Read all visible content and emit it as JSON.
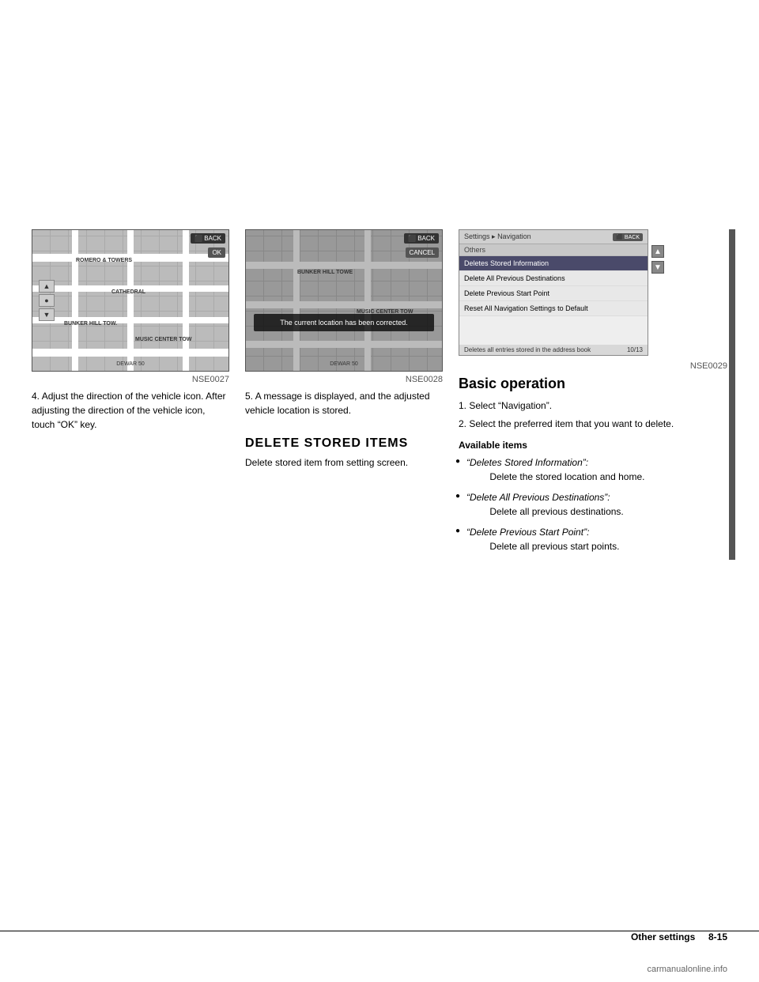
{
  "page": {
    "background": "#ffffff",
    "section": "Other settings",
    "page_number": "8-15"
  },
  "images": {
    "first": {
      "caption": "NSE0027",
      "alt": "Map showing vehicle direction adjustment with OK button"
    },
    "second": {
      "caption": "NSE0028",
      "alt": "Map with message: The current location has been corrected.",
      "message": "The current location has been corrected."
    },
    "third": {
      "caption": "NSE0029",
      "alt": "Navigation Settings menu showing delete options",
      "header_title": "Settings",
      "header_subtitle": "Navigation",
      "section_label": "Others",
      "menu_items": [
        {
          "label": "Deletes Stored Information",
          "selected": true
        },
        {
          "label": "Delete All Previous Destinations",
          "selected": false
        },
        {
          "label": "Delete Previous Start Point",
          "selected": false
        },
        {
          "label": "Reset All Navigation Settings to Default",
          "selected": false
        }
      ],
      "footer_text": "Deletes all entries stored in the address book",
      "page_indicator": "10/13"
    }
  },
  "steps": {
    "step4": {
      "number": "4.",
      "text": "Adjust the direction of the vehicle icon. After adjusting the direction of the vehicle icon, touch “OK” key."
    },
    "step5": {
      "number": "5.",
      "text": "A message is displayed, and the adjusted vehicle location is stored."
    }
  },
  "delete_section": {
    "heading": "DELETE STORED ITEMS",
    "subtext": "Delete stored item from setting screen."
  },
  "basic_operation": {
    "heading": "Basic operation",
    "step1": "1.  Select “Navigation”.",
    "step2": "2.  Select the preferred item that you want to delete.",
    "available_items_heading": "Available items",
    "items": [
      {
        "label": "“Deletes Stored Information”:",
        "description": "Delete the stored location and home."
      },
      {
        "label": "“Delete All Previous Destinations”:",
        "description": "Delete all previous destinations."
      },
      {
        "label": "“Delete Previous Start Point”:",
        "description": "Delete all previous start points."
      }
    ]
  },
  "footer": {
    "section_label": "Other settings",
    "page_number": "8-15",
    "watermark": "carmanualonline.info"
  }
}
